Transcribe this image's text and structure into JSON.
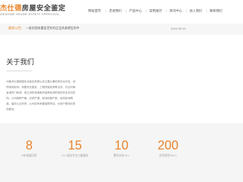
{
  "brand": {
    "name_accent": "杰仕德",
    "name_rest": "房屋安全鉴定",
    "tagline": "JIESHIDE HOUSE SAFETY APPRAISAL"
  },
  "nav": {
    "items": [
      "网站首页",
      "走进我们",
      "产品中心",
      "案例展示",
      "资讯中心",
      "加入我们",
      "联系我们"
    ],
    "separator": "|"
  },
  "notice": {
    "label": "最新公告：",
    "text": "一级房屋质量鉴定机构应当具备哪些条件",
    "date": "2023-05-23"
  },
  "about": {
    "title": "关于我们",
    "body": "河南杰仕德房屋安全鉴定有限公司主要从事危房安全评估、消防验收检测、房屋安全鉴定、工程质量检测等业务，并且河南省消防门检测，成立消防设施维护保养检测机构的安全评估机构。公司拥有严格、优质严谨，检测设备严密，检测技术精湛、保存公正科学。公司自有承建保障项目，为用户提供优质的服务。"
  },
  "stats": [
    {
      "value": "8",
      "label": "8年发展历程"
    },
    {
      "value": "15",
      "label": "15+团队专业力量服务"
    },
    {
      "value": "10",
      "label": "累积业务10+"
    },
    {
      "value": "200",
      "label": "优秀项目200+"
    }
  ],
  "colors": {
    "accent": "#e9852d",
    "notice_bg": "#f6f6f6",
    "stats_bg": "#f5f5f5"
  }
}
